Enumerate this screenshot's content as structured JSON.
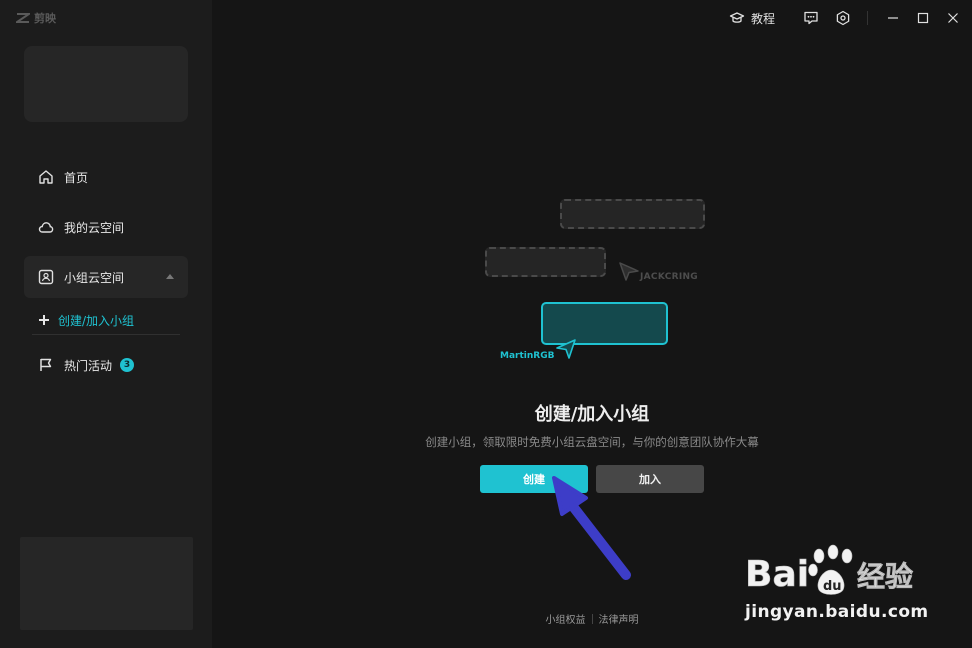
{
  "app": {
    "name": "剪映",
    "logo_icon": "capcut-logo-icon"
  },
  "titlebar": {
    "tutorial_label": "教程",
    "icons": [
      "graduation-cap-icon",
      "feedback-icon",
      "settings-icon",
      "minimize-icon",
      "maximize-icon",
      "close-icon"
    ]
  },
  "sidebar": {
    "items": [
      {
        "label": "首页",
        "icon": "home-icon"
      },
      {
        "label": "我的云空间",
        "icon": "cloud-icon"
      },
      {
        "label": "小组云空间",
        "icon": "group-space-icon"
      },
      {
        "label": "热门活动",
        "icon": "flag-icon",
        "badge": "3"
      }
    ],
    "sub_item": {
      "label": "创建/加入小组",
      "icon": "plus-icon"
    }
  },
  "illustration": {
    "label_gray": "JACKCRING",
    "label_cyan": "MartinRGB"
  },
  "main": {
    "title": "创建/加入小组",
    "description": "创建小组，领取限时免费小组云盘空间，与你的创意团队协作大幕",
    "create_button": "创建",
    "join_button": "加入"
  },
  "footer": {
    "links": [
      "小组权益",
      "法律声明"
    ]
  },
  "watermark": {
    "text": "jingyan.baidu.com",
    "brand": "Bai度经验"
  },
  "colors": {
    "accent": "#1fc2d1",
    "background": "#151515",
    "sidebar": "#1c1c1c",
    "annotation_arrow": "#3d3dc8"
  }
}
